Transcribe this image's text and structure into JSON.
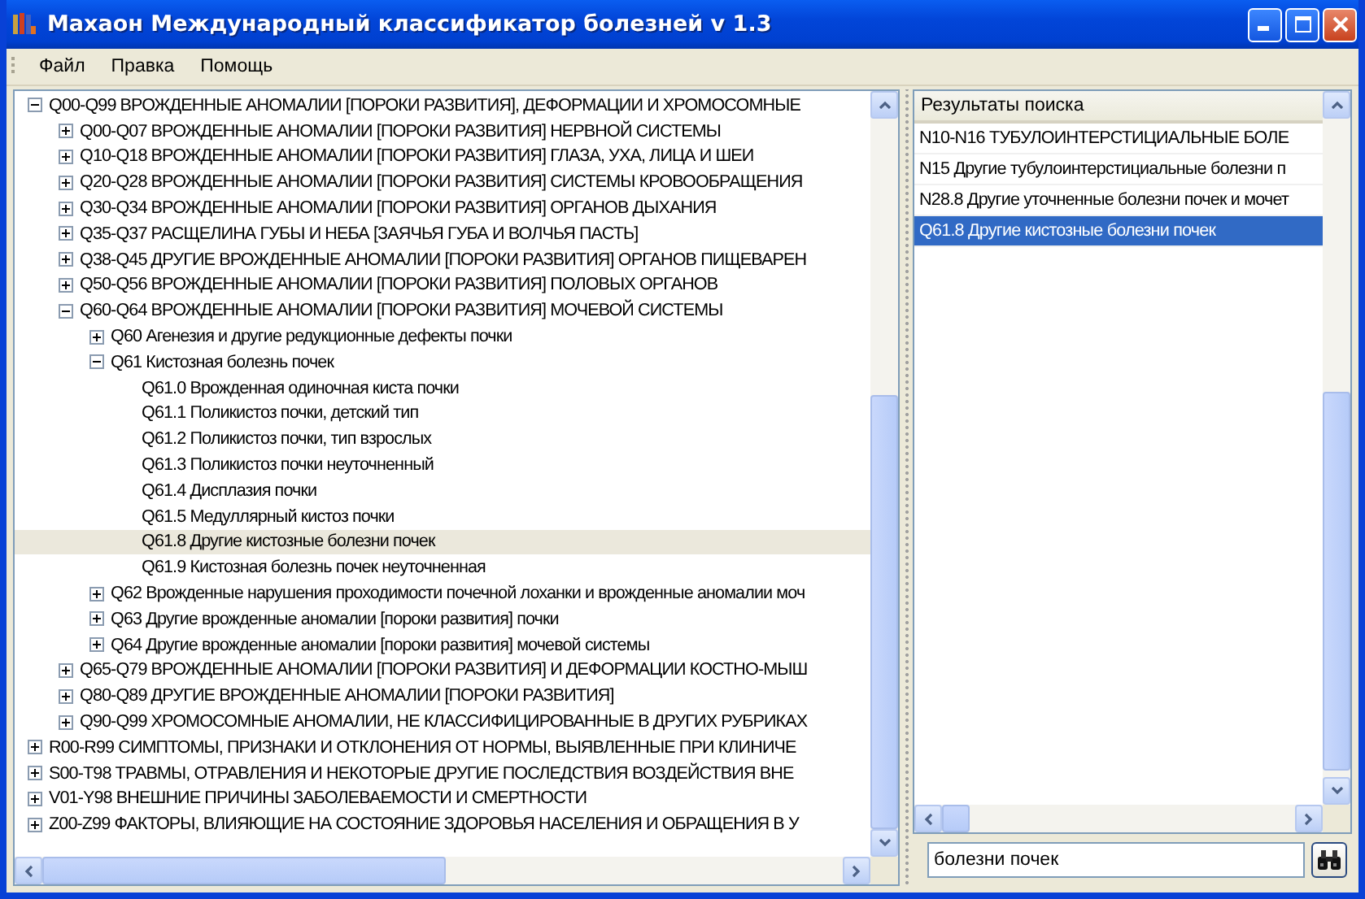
{
  "window": {
    "title": "Махаон Международный классификатор болезней v 1.3"
  },
  "menu": [
    "Файл",
    "Правка",
    "Помощь"
  ],
  "tree": [
    {
      "label": "Q00-Q99 ВРОЖДЕННЫЕ АНОМАЛИИ [ПОРОКИ РАЗВИТИЯ], ДЕФОРМАЦИИ И ХРОМОСОМНЫЕ",
      "expanded": true,
      "selected": false,
      "children": [
        {
          "label": "Q00-Q07 ВРОЖДЕННЫЕ АНОМАЛИИ [ПОРОКИ РАЗВИТИЯ] НЕРВНОЙ СИСТЕМЫ",
          "expanded": false,
          "selected": false
        },
        {
          "label": "Q10-Q18 ВРОЖДЕННЫЕ АНОМАЛИИ [ПОРОКИ РАЗВИТИЯ] ГЛАЗА, УХА, ЛИЦА И ШЕИ",
          "expanded": false,
          "selected": false
        },
        {
          "label": "Q20-Q28 ВРОЖДЕННЫЕ АНОМАЛИИ [ПОРОКИ РАЗВИТИЯ] СИСТЕМЫ КРОВООБРАЩЕНИЯ",
          "expanded": false,
          "selected": false
        },
        {
          "label": "Q30-Q34 ВРОЖДЕННЫЕ АНОМАЛИИ [ПОРОКИ РАЗВИТИЯ] ОРГАНОВ ДЫХАНИЯ",
          "expanded": false,
          "selected": false
        },
        {
          "label": "Q35-Q37 РАСЩЕЛИНА ГУБЫ И НЕБА [ЗАЯЧЬЯ ГУБА И ВОЛЧЬЯ ПАСТЬ]",
          "expanded": false,
          "selected": false
        },
        {
          "label": "Q38-Q45 ДРУГИЕ ВРОЖДЕННЫЕ АНОМАЛИИ [ПОРОКИ РАЗВИТИЯ] ОРГАНОВ ПИЩЕВАРЕН",
          "expanded": false,
          "selected": false
        },
        {
          "label": "Q50-Q56 ВРОЖДЕННЫЕ АНОМАЛИИ [ПОРОКИ РАЗВИТИЯ] ПОЛОВЫХ ОРГАНОВ",
          "expanded": false,
          "selected": false
        },
        {
          "label": "Q60-Q64 ВРОЖДЕННЫЕ АНОМАЛИИ [ПОРОКИ РАЗВИТИЯ] МОЧЕВОЙ СИСТЕМЫ",
          "expanded": true,
          "selected": false,
          "children": [
            {
              "label": "Q60 Агенезия и другие редукционные дефекты почки",
              "expanded": false,
              "selected": false
            },
            {
              "label": "Q61 Кистозная болезнь почек",
              "expanded": true,
              "selected": false,
              "children": [
                {
                  "label": "Q61.0 Врожденная одиночная киста почки",
                  "selected": false
                },
                {
                  "label": "Q61.1 Поликистоз почки, детский тип",
                  "selected": false
                },
                {
                  "label": "Q61.2 Поликистоз почки, тип взрослых",
                  "selected": false
                },
                {
                  "label": "Q61.3 Поликистоз почки неуточненный",
                  "selected": false
                },
                {
                  "label": "Q61.4 Дисплазия почки",
                  "selected": false
                },
                {
                  "label": "Q61.5 Медуллярный кистоз почки",
                  "selected": false
                },
                {
                  "label": "Q61.8 Другие кистозные болезни почек",
                  "selected": true
                },
                {
                  "label": "Q61.9 Кистозная болезнь почек неуточненная",
                  "selected": false
                }
              ]
            },
            {
              "label": "Q62 Врожденные нарушения проходимости почечной лоханки и врожденные аномалии моч",
              "expanded": false,
              "selected": false
            },
            {
              "label": "Q63 Другие врожденные аномалии [пороки развития] почки",
              "expanded": false,
              "selected": false
            },
            {
              "label": "Q64 Другие врожденные аномалии [пороки развития] мочевой системы",
              "expanded": false,
              "selected": false
            }
          ]
        },
        {
          "label": "Q65-Q79 ВРОЖДЕННЫЕ АНОМАЛИИ [ПОРОКИ РАЗВИТИЯ] И ДЕФОРМАЦИИ КОСТНО-МЫШ",
          "expanded": false,
          "selected": false
        },
        {
          "label": "Q80-Q89 ДРУГИЕ ВРОЖДЕННЫЕ АНОМАЛИИ [ПОРОКИ РАЗВИТИЯ]",
          "expanded": false,
          "selected": false
        },
        {
          "label": "Q90-Q99 ХРОМОСОМНЫЕ АНОМАЛИИ, НЕ КЛАССИФИЦИРОВАННЫЕ В ДРУГИХ РУБРИКАХ",
          "expanded": false,
          "selected": false
        }
      ]
    },
    {
      "label": "R00-R99 СИМПТОМЫ, ПРИЗНАКИ И ОТКЛОНЕНИЯ ОТ НОРМЫ, ВЫЯВЛЕННЫЕ ПРИ КЛИНИЧЕ",
      "expanded": false,
      "selected": false
    },
    {
      "label": "S00-T98 ТРАВМЫ, ОТРАВЛЕНИЯ И НЕКОТОРЫЕ ДРУГИЕ ПОСЛЕДСТВИЯ ВОЗДЕЙСТВИЯ ВНЕ",
      "expanded": false,
      "selected": false
    },
    {
      "label": "V01-Y98 ВНЕШНИЕ ПРИЧИНЫ ЗАБОЛЕВАЕМОСТИ И СМЕРТНОСТИ",
      "expanded": false,
      "selected": false
    },
    {
      "label": "Z00-Z99 ФАКТОРЫ, ВЛИЯЮЩИЕ НА СОСТОЯНИЕ ЗДОРОВЬЯ НАСЕЛЕНИЯ И ОБРАЩЕНИЯ В У",
      "expanded": false,
      "selected": false
    }
  ],
  "results": {
    "header": "Результаты поиска",
    "items": [
      {
        "label": "N10-N16 ТУБУЛОИНТЕРСТИЦИАЛЬНЫЕ БОЛЕ",
        "selected": false
      },
      {
        "label": "N15 Другие тубулоинтерстициальные болезни п",
        "selected": false
      },
      {
        "label": "N28.8 Другие уточненные болезни почек и мочет",
        "selected": false
      },
      {
        "label": "Q61.8 Другие кистозные болезни почек",
        "selected": true
      }
    ]
  },
  "search": {
    "value": "болезни почек"
  }
}
